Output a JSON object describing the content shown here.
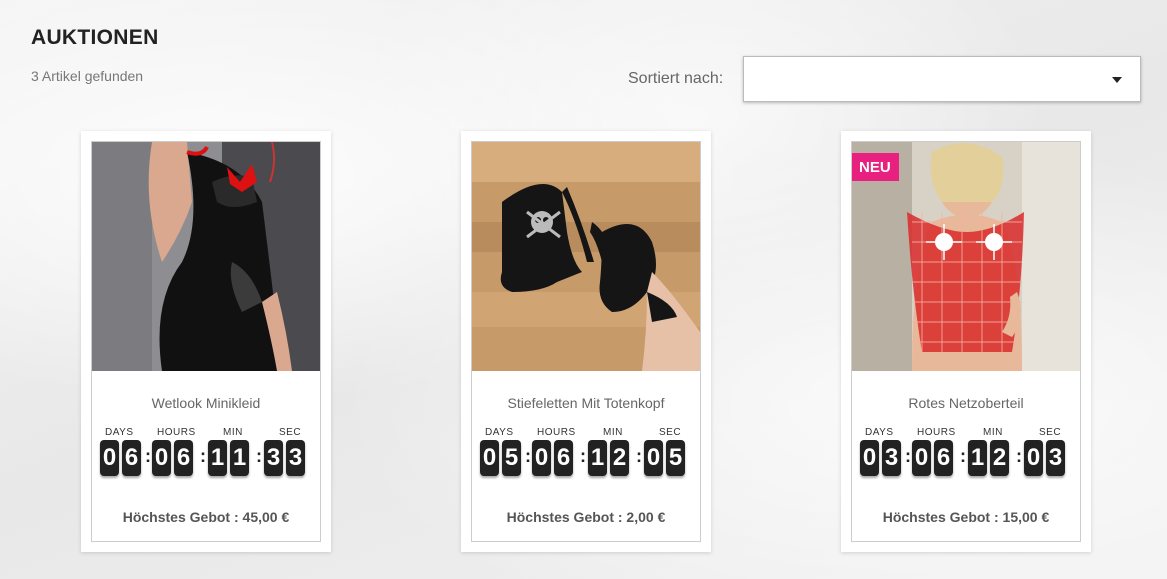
{
  "header": {
    "title": "AUKTIONEN",
    "result_count": "3 Artikel gefunden",
    "sort_label": "Sortiert nach:",
    "sort_value": ""
  },
  "countdown_labels": {
    "days": "DAYS",
    "hours": "HOURS",
    "min": "MIN",
    "sec": "SEC"
  },
  "products": [
    {
      "name": "Wetlook Minikleid",
      "badge": "",
      "days": "06",
      "hours": "06",
      "min": "11",
      "sec": "33",
      "highest_bid": "Höchstes Gebot : 45,00 €"
    },
    {
      "name": "Stiefeletten Mit Totenkopf",
      "badge": "",
      "days": "05",
      "hours": "06",
      "min": "12",
      "sec": "05",
      "highest_bid": "Höchstes Gebot : 2,00 €"
    },
    {
      "name": "Rotes Netzoberteil",
      "badge": "NEU",
      "days": "03",
      "hours": "06",
      "min": "12",
      "sec": "03",
      "highest_bid": "Höchstes Gebot : 15,00 €"
    }
  ],
  "colors": {
    "badge": "#e8207f",
    "digit_bg": "#222222"
  }
}
